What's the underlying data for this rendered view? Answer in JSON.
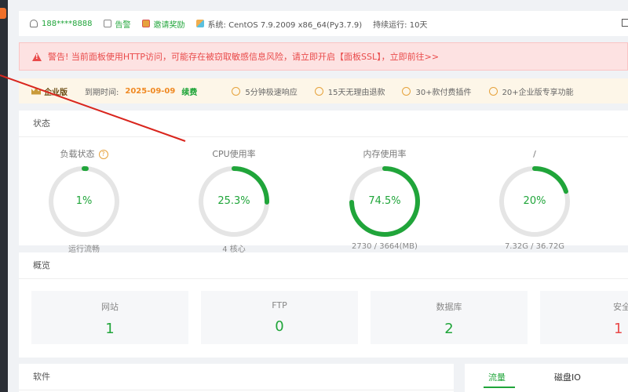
{
  "topbar": {
    "user": "188****8888",
    "alarm": "告警",
    "invite": "邀请奖励",
    "system": "系统:  CentOS 7.9.2009 x86_64(Py3.7.9)",
    "uptime": "持续运行: 10天"
  },
  "alert": {
    "text": "警告! 当前面板使用HTTP访问，可能存在被窃取敏感信息风险，请立即开启【面板SSL】，立即前往>>"
  },
  "enterprise": {
    "title": "企业版",
    "expire_label": "到期时间:",
    "expire_date": "2025-09-09",
    "renew": "续费",
    "features": [
      "5分钟极速响应",
      "15天无理由退款",
      "30+款付费插件",
      "20+企业版专享功能"
    ]
  },
  "status": {
    "title": "状态",
    "gauges": [
      {
        "label": "负载状态",
        "value": "1%",
        "percent": 1,
        "sub": "运行流畅",
        "help": "?"
      },
      {
        "label": "CPU使用率",
        "value": "25.3%",
        "percent": 25.3,
        "sub": "4 核心"
      },
      {
        "label": "内存使用率",
        "value": "74.5%",
        "percent": 74.5,
        "sub": "2730 / 3664(MB)"
      },
      {
        "label": "/",
        "value": "20%",
        "percent": 20,
        "sub": "7.32G / 36.72G"
      }
    ]
  },
  "overview": {
    "title": "概览",
    "items": [
      {
        "label": "网站",
        "value": "1"
      },
      {
        "label": "FTP",
        "value": "0"
      },
      {
        "label": "数据库",
        "value": "2"
      },
      {
        "label": "安全风",
        "value": "1"
      }
    ]
  },
  "software": {
    "title": "软件"
  },
  "network": {
    "tabs": [
      "流量",
      "磁盘IO"
    ]
  },
  "colors": {
    "accent": "#20a53a",
    "danger": "#e94a4a",
    "ring_bg": "#e5e5e5",
    "warning": "#f08a24"
  }
}
